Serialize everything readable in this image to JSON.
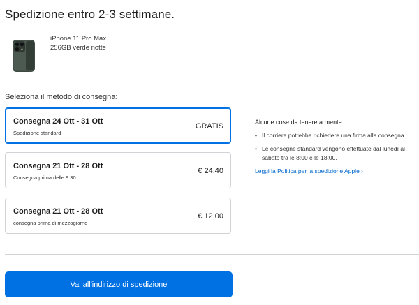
{
  "header": {
    "title": "Spedizione entro 2-3 settimane."
  },
  "product": {
    "name": "iPhone 11 Pro Max",
    "variant": "256GB verde notte",
    "image_icon": "iphone-11-pro-max-image"
  },
  "delivery": {
    "section_label": "Seleziona il metodo di consegna:",
    "selected_index": 0,
    "options": [
      {
        "title": "Consegna 24 Ott - 31 Ott",
        "subtitle": "Spedizione standard",
        "price": "GRATIS"
      },
      {
        "title": "Consegna 21 Ott - 28 Ott",
        "subtitle": "Consegna prima delle 9:30",
        "price": "€ 24,40"
      },
      {
        "title": "Consegna 21 Ott - 28 Ott",
        "subtitle": "consegna prima di mezzogiorno",
        "price": "€ 12,00"
      }
    ]
  },
  "info": {
    "title": "Alcune cose da tenere a mente",
    "bullets": [
      "Il corriere potrebbe richiedere una firma alla consegna.",
      "Le consegne standard vengono effettuate dal lunedì al sabato tra le 8:00 e le 18:00."
    ],
    "link_label": "Leggi la Politica per la spedizione Apple ›"
  },
  "cta": {
    "label": "Vai all'indirizzo di spedizione"
  },
  "colors": {
    "accent": "#0071e3",
    "link": "#0066cc",
    "border": "#d2d2d7",
    "text": "#1d1d1f"
  }
}
